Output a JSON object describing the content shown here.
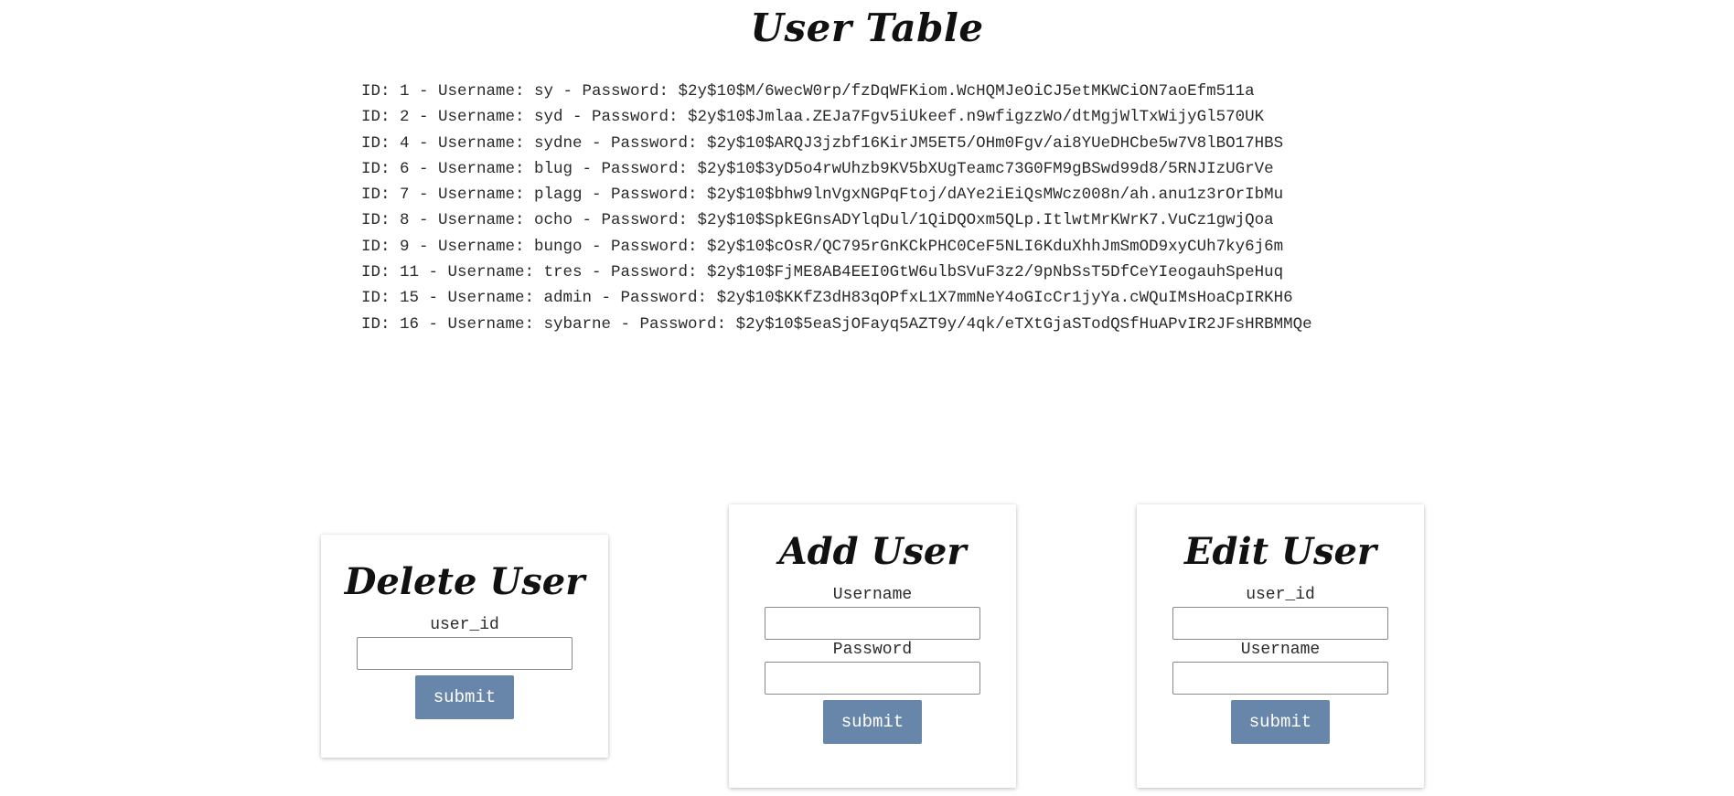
{
  "header": {
    "title": "User Table"
  },
  "users": [
    "ID: 1 - Username: sy - Password: $2y$10$M/6wecW0rp/fzDqWFKiom.WcHQMJeOiCJ5etMKWCiON7aoEfm511a",
    "ID: 2 - Username: syd - Password: $2y$10$Jmlaa.ZEJa7Fgv5iUkeef.n9wfigzzWo/dtMgjWlTxWijyGl570UK",
    "ID: 4 - Username: sydne - Password: $2y$10$ARQJ3jzbf16KirJM5ET5/OHm0Fgv/ai8YUeDHCbe5w7V8lBO17HBS",
    "ID: 6 - Username: blug - Password: $2y$10$3yD5o4rwUhzb9KV5bXUgTeamc73G0FM9gBSwd99d8/5RNJIzUGrVe",
    "ID: 7 - Username: plagg - Password: $2y$10$bhw9lnVgxNGPqFtoj/dAYe2iEiQsMWcz008n/ah.anu1z3rOrIbMu",
    "ID: 8 - Username: ocho - Password: $2y$10$SpkEGnsADYlqDul/1QiDQOxm5QLp.ItlwtMrKWrK7.VuCz1gwjQoa",
    "ID: 9 - Username: bungo - Password: $2y$10$cOsR/QC795rGnKCkPHC0CeF5NLI6KduXhhJmSmOD9xyCUh7ky6j6m",
    "ID: 11 - Username: tres - Password: $2y$10$FjME8AB4EEI0GtW6ulbSVuF3z2/9pNbSsT5DfCeYIeogauhSpeHuq",
    "ID: 15 - Username: admin - Password: $2y$10$KKfZ3dH83qOPfxL1X7mmNeY4oGIcCr1jyYa.cWQuIMsHoaCpIRKH6",
    "ID: 16 - Username: sybarne - Password: $2y$10$5eaSjOFayq5AZT9y/4qk/eTXtGjaSTodQSfHuAPvIR2JFsHRBMMQe"
  ],
  "delete_form": {
    "title": "Delete User",
    "field1_label": "user_id",
    "field1_value": "",
    "submit_label": "submit"
  },
  "add_form": {
    "title": "Add User",
    "field1_label": "Username",
    "field1_value": "",
    "field2_label": "Password",
    "field2_value": "",
    "submit_label": "submit"
  },
  "edit_form": {
    "title": "Edit User",
    "field1_label": "user_id",
    "field1_value": "",
    "field2_label": "Username",
    "field2_value": "",
    "submit_label": "submit"
  }
}
